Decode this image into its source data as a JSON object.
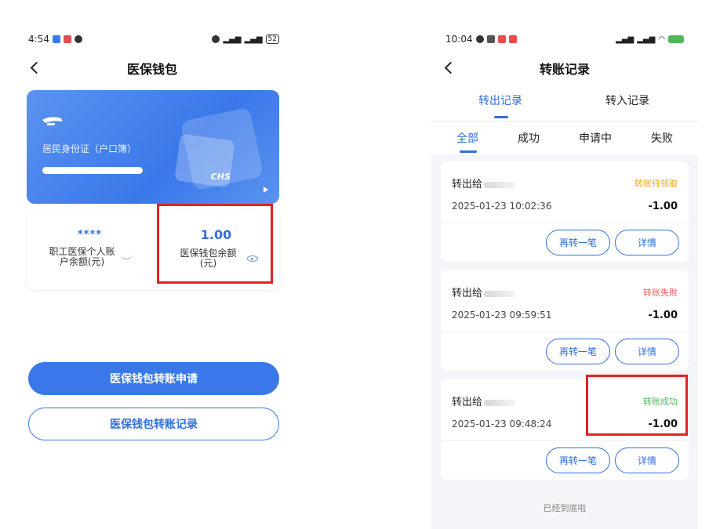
{
  "left": {
    "status": {
      "time": "4:54",
      "battery": "52"
    },
    "title": "医保钱包",
    "card": {
      "id_type": "居民身份证（户口簿）",
      "brand": "CHS"
    },
    "balances": [
      {
        "value": "****",
        "label": "职工医保个人账户余额(元)"
      },
      {
        "value": "1.00",
        "label": "医保钱包余额(元)"
      }
    ],
    "buttons": {
      "apply": "医保钱包转账申请",
      "records": "医保钱包转账记录"
    }
  },
  "right": {
    "status": {
      "time": "10:04"
    },
    "title": "转账记录",
    "tabs": [
      "转出记录",
      "转入记录"
    ],
    "filters": [
      "全部",
      "成功",
      "申请中",
      "失败"
    ],
    "records": [
      {
        "to": "转出给",
        "status": "转账待领取",
        "time": "2025-01-23 10:02:36",
        "amount": "-1.00"
      },
      {
        "to": "转出给",
        "status": "转账失败",
        "time": "2025-01-23 09:59:51",
        "amount": "-1.00"
      },
      {
        "to": "转出给",
        "status": "转账成功",
        "time": "2025-01-23 09:48:24",
        "amount": "-1.00"
      }
    ],
    "record_buttons": {
      "again": "再转一笔",
      "detail": "详情"
    },
    "footer": "已经到底啦"
  },
  "colors": {
    "primary": "#3a78ea",
    "pending": "#e8a822",
    "fail": "#ec5c5c",
    "success": "#4fb85a",
    "highlight": "#e02424"
  }
}
